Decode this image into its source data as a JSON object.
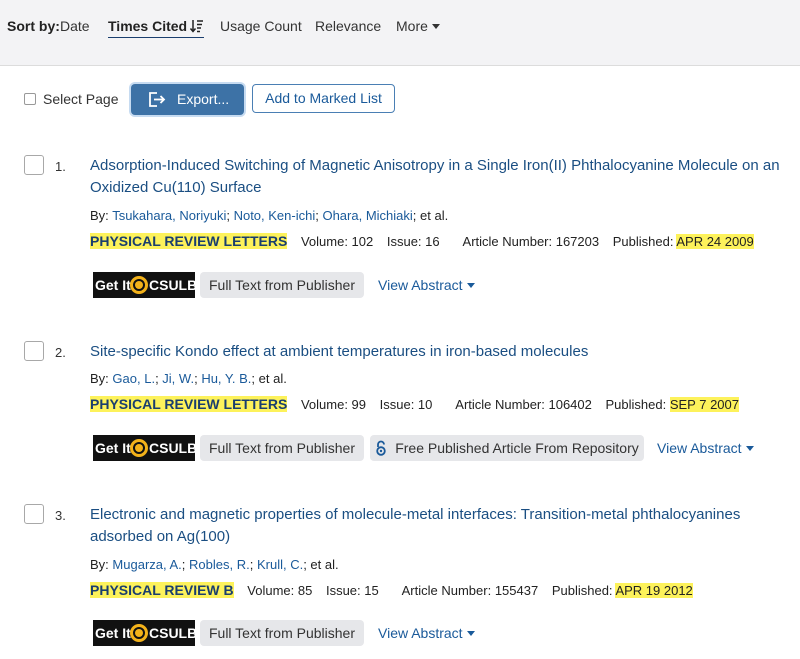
{
  "sort": {
    "label": "Sort by:",
    "options": [
      "Date",
      "Times Cited",
      "Usage Count",
      "Relevance",
      "More"
    ],
    "active": "Times Cited"
  },
  "toolbar": {
    "select_page": "Select Page",
    "export": "Export...",
    "add_marked": "Add to Marked List"
  },
  "records": [
    {
      "num": "1.",
      "title": "Adsorption-Induced Switching of Magnetic Anisotropy in a Single Iron(II) Phthalocyanine Molecule on an Oxidized Cu(110) Surface",
      "by": "By:",
      "authors": [
        "Tsukahara, Noriyuki",
        "Noto, Ken-ichi",
        "Ohara, Michiaki"
      ],
      "etal": "; et al.",
      "journal": "PHYSICAL REVIEW LETTERS",
      "volume": "Volume: 102",
      "issue": "Issue: 16",
      "article": "Article Number: 167203",
      "published_label": "Published:",
      "published": "APR 24 2009",
      "links": {
        "getit1": "Get It",
        "getit2": "CSULB",
        "fulltext": "Full Text from Publisher",
        "view_abstract": "View Abstract"
      }
    },
    {
      "num": "2.",
      "title": "Site-specific Kondo effect at ambient temperatures in iron-based molecules",
      "by": "By:",
      "authors": [
        "Gao, L.",
        "Ji, W.",
        "Hu, Y. B."
      ],
      "etal": "; et al.",
      "journal": "PHYSICAL REVIEW LETTERS",
      "volume": "Volume: 99",
      "issue": "Issue: 10",
      "article": "Article Number: 106402",
      "published_label": "Published:",
      "published": "SEP 7 2007",
      "links": {
        "getit1": "Get It",
        "getit2": "CSULB",
        "fulltext": "Full Text from Publisher",
        "free": "Free Published Article From Repository",
        "view_abstract": "View Abstract"
      }
    },
    {
      "num": "3.",
      "title": "Electronic and magnetic properties of molecule-metal interfaces: Transition-metal phthalocyanines adsorbed on Ag(100)",
      "by": "By:",
      "authors": [
        "Mugarza, A.",
        "Robles, R.",
        "Krull, C."
      ],
      "etal": "; et al.",
      "journal": "PHYSICAL REVIEW B",
      "volume": "Volume: 85",
      "issue": "Issue: 15",
      "article": "Article Number: 155437",
      "published_label": "Published:",
      "published": "APR 19 2012",
      "links": {
        "getit1": "Get It",
        "getit2": "CSULB",
        "fulltext": "Full Text from Publisher",
        "view_abstract": "View Abstract"
      }
    }
  ],
  "colors": {
    "highlight": "#fdf25b",
    "link": "#1a5a9a",
    "export_bg": "#3d72a6"
  }
}
